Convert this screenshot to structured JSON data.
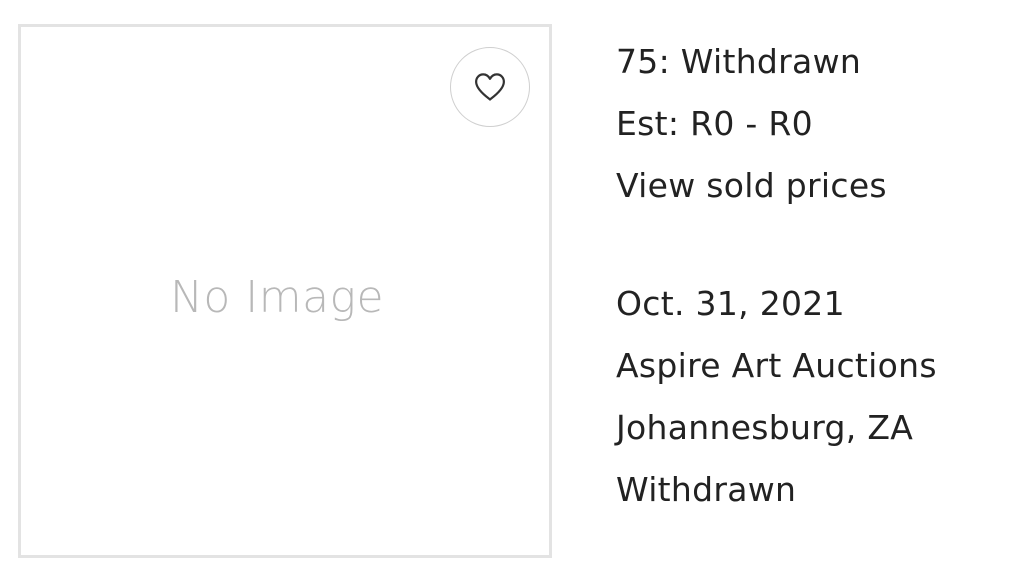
{
  "lot": {
    "image_placeholder": "No Image",
    "favorite_icon": "heart-outline-icon",
    "title": "75: Withdrawn",
    "estimate": "Est: R0 - R0",
    "sold_prices_link": "View sold prices",
    "date": "Oct. 31, 2021",
    "auction_house": "Aspire Art Auctions",
    "location": "Johannesburg, ZA",
    "status": "Withdrawn"
  },
  "colors": {
    "frame_border": "#e3e3e3",
    "placeholder_text": "#b8b8b8",
    "text": "#222222"
  }
}
